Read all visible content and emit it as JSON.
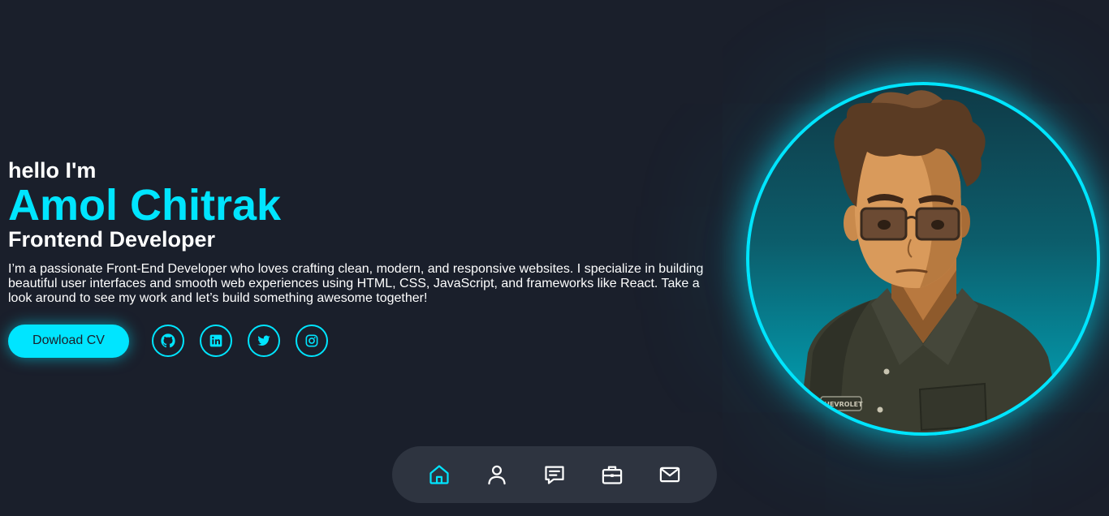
{
  "hero": {
    "greeting": "hello I'm",
    "name": "Amol Chitrak",
    "role": "Frontend Developer",
    "bio": "I’m a passionate Front-End Developer who loves crafting clean, modern, and responsive websites. I specialize in building beautiful user interfaces and smooth web experiences using HTML, CSS, JavaScript, and frameworks like React. Take a look around to see my work and let’s build something awesome together!",
    "cv_button": "Dowload CV"
  },
  "socials": [
    {
      "icon": "github-icon"
    },
    {
      "icon": "linkedin-icon"
    },
    {
      "icon": "twitter-icon"
    },
    {
      "icon": "instagram-icon"
    }
  ],
  "avatar": {
    "badge_text": "CHEVROLET"
  },
  "nav": {
    "items": [
      {
        "icon": "home-icon",
        "active": true
      },
      {
        "icon": "user-icon",
        "active": false
      },
      {
        "icon": "message-icon",
        "active": false
      },
      {
        "icon": "briefcase-icon",
        "active": false
      },
      {
        "icon": "mail-icon",
        "active": false
      }
    ]
  },
  "colors": {
    "background": "#1a1f2b",
    "accent": "#00e5ff",
    "nav_background": "#2e3440",
    "text": "#ffffff"
  }
}
